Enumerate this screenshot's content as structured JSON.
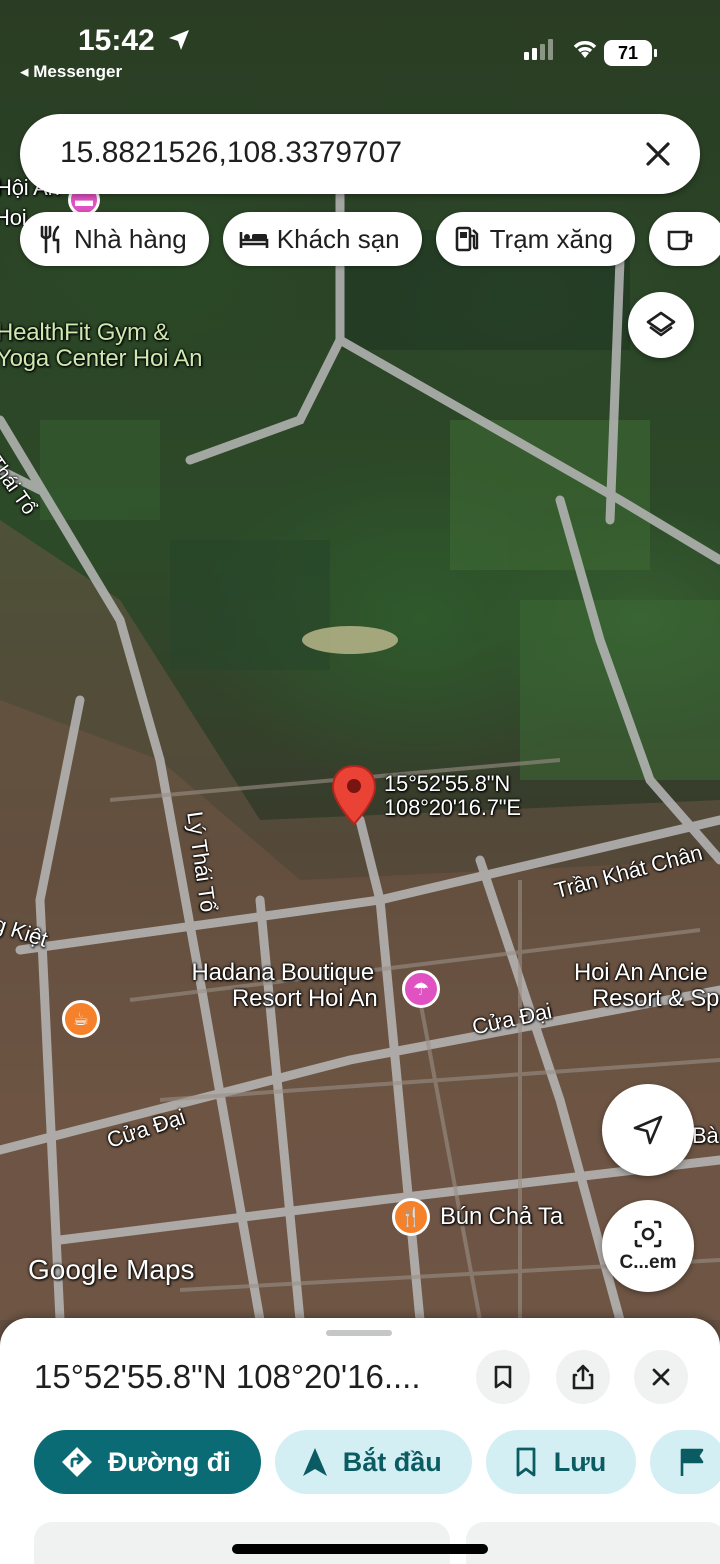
{
  "status_bar": {
    "time": "15:42",
    "back_app": "◂ Messenger",
    "battery": "71"
  },
  "search": {
    "query": "15.8821526,108.3379707"
  },
  "chips": [
    {
      "icon": "restaurant-icon",
      "label": "Nhà hàng"
    },
    {
      "icon": "hotel-icon",
      "label": "Khách sạn"
    },
    {
      "icon": "gas-station-icon",
      "label": "Trạm xăng"
    },
    {
      "icon": "coffee-icon",
      "label": ""
    }
  ],
  "map": {
    "labels": {
      "gym_line1": "HealthFit Gym &",
      "gym_line2": "Yoga Center Hoi An",
      "hoi_an_top": "Hội An",
      "hoi_top2": "Hoi",
      "thai_to": "Thái Tổ",
      "ly_thai_to": "Lý Thái Tổ",
      "kiet": "g Kiệt",
      "tran_khat_chan": "Trần Khát Chân",
      "hadana_line1": "Hadana Boutique",
      "hadana_line2": "Resort Hoi An",
      "hoi_an_ancient_line1": "Hoi An Ancie",
      "hoi_an_ancient_line2": "Resort & Sp",
      "cua_dai_right": "Cửa Đại",
      "cua_dai_left": "Cửa Đại",
      "bun_cha_ta": "Bún Chả Ta",
      "ba_partial": "Bà p"
    },
    "pin": {
      "lat": "15°52'55.8\"N",
      "lng": "108°20'16.7\"E"
    },
    "logo": "Google Maps"
  },
  "fabs": {
    "layers": "layers-icon",
    "locate": "navigation-arrow-icon",
    "lens_label": "C...em"
  },
  "sheet": {
    "coords": "15°52'55.8\"N 108°20'16....",
    "actions": [
      {
        "icon": "directions-icon",
        "label": "Đường đi"
      },
      {
        "icon": "start-arrow-icon",
        "label": "Bắt đầu"
      },
      {
        "icon": "bookmark-icon",
        "label": "Lưu"
      },
      {
        "icon": "flag-icon",
        "label": ""
      }
    ]
  },
  "colors": {
    "primary_teal": "#0b6b74",
    "chip_tint": "#d3eff3",
    "pin_red": "#ea4335",
    "poi_pink": "#e052c2",
    "poi_orange": "#f5822a"
  }
}
